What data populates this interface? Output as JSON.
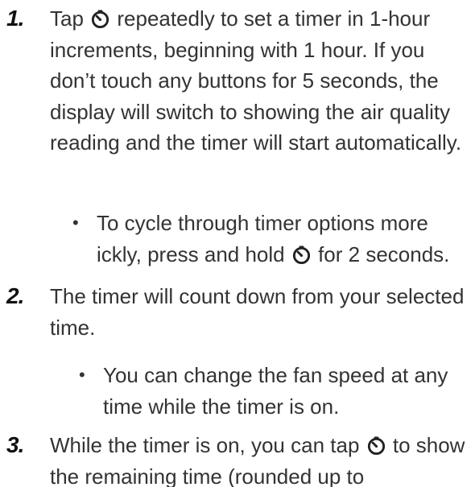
{
  "steps": [
    {
      "num": "1.",
      "before_icon": "Tap ",
      "icon": "timer-icon",
      "after_icon": " repeatedly to set a timer in 1-hour increments, beginning with 1 hour. If you don’t touch any buttons for 5 seconds, the display will switch to showing the air quality reading and the timer will start automatically.",
      "sub": {
        "before_icon": "To cycle through timer options more ickly, press and hold ",
        "icon": "timer-icon",
        "after_icon": " for 2 seconds."
      }
    },
    {
      "num": "2.",
      "text": "The timer will count down from your selected time.",
      "sub": {
        "text": "You can change the fan speed at any time while the timer is on."
      }
    },
    {
      "num": "3.",
      "before_icon": "While the timer is on, you can tap ",
      "icon": "timer-icon",
      "after_icon": " to show the remaining time (rounded up to"
    }
  ],
  "bullet_glyph": "•",
  "colors": {
    "text": "#333333",
    "number": "#111111"
  }
}
